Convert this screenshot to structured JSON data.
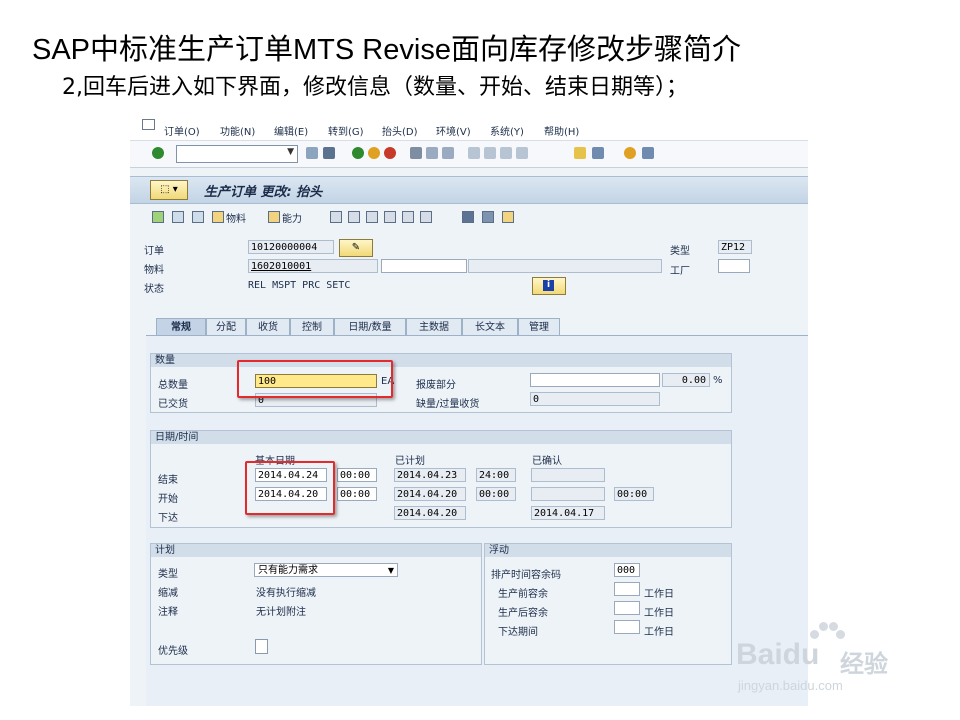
{
  "slide": {
    "title": "SAP中标准生产订单MTS Revise面向库存修改步骤简介",
    "subtitle": "2,回车后进入如下界面，修改信息（数量、开始、结束日期等）；"
  },
  "menu": [
    "订单(O)",
    "功能(N)",
    "编辑(E)",
    "转到(G)",
    "抬头(D)",
    "环境(V)",
    "系统(Y)",
    "帮助(H)"
  ],
  "screen": {
    "title": "生产订单 更改: 抬头"
  },
  "app_toolbar": {
    "material_label": "物料",
    "capacity_label": "能力"
  },
  "header": {
    "order_label": "订单",
    "order_value": "10120000004",
    "material_label": "物料",
    "material_value": "1602010001",
    "status_label": "状态",
    "status_value": "REL  MSPT PRC  SETC",
    "type_label": "类型",
    "type_value": "ZP12",
    "plant_label": "工厂",
    "plant_value": ""
  },
  "tabs": [
    "常规",
    "分配",
    "收货",
    "控制",
    "日期/数量",
    "主数据",
    "长文本",
    "管理"
  ],
  "quantity": {
    "heading": "数量",
    "total_label": "总数量",
    "total_value": "100",
    "unit": "EA",
    "scrap_label": "报废部分",
    "scrap_value": "",
    "scrap_pct": "0.00",
    "pct_sign": "%",
    "delivered_label": "已交货",
    "delivered_value": "0",
    "short_label": "缺量/过量收货",
    "short_value": "0"
  },
  "dates": {
    "heading": "日期/时间",
    "col_basic": "基本日期",
    "col_scheduled": "已计划",
    "col_confirmed": "已确认",
    "end_label": "结束",
    "end_basic": "2014.04.24",
    "end_basic_time": "00:00",
    "end_sched": "2014.04.23",
    "end_sched_time": "24:00",
    "start_label": "开始",
    "start_basic": "2014.04.20",
    "start_basic_time": "00:00",
    "start_sched": "2014.04.20",
    "start_sched_time": "00:00",
    "start_conf_time": "00:00",
    "release_label": "下达",
    "release_sched": "2014.04.20",
    "release_conf": "2014.04.17"
  },
  "plan": {
    "heading": "计划",
    "type_label": "类型",
    "type_value": "只有能力需求",
    "reduce_label": "缩减",
    "reduce_value": "没有执行缩减",
    "note_label": "注释",
    "note_value": "无计划附注",
    "priority_label": "优先级"
  },
  "float": {
    "heading": "浮动",
    "sched_margin_label": "排产时间容余码",
    "sched_margin_value": "000",
    "before_label": "生产前容余",
    "after_label": "生产后容余",
    "release_label": "下达期间",
    "unit": "工作日"
  },
  "watermark": {
    "logo": "Baidu",
    "cn": "经验",
    "url": "jingyan.baidu.com"
  }
}
